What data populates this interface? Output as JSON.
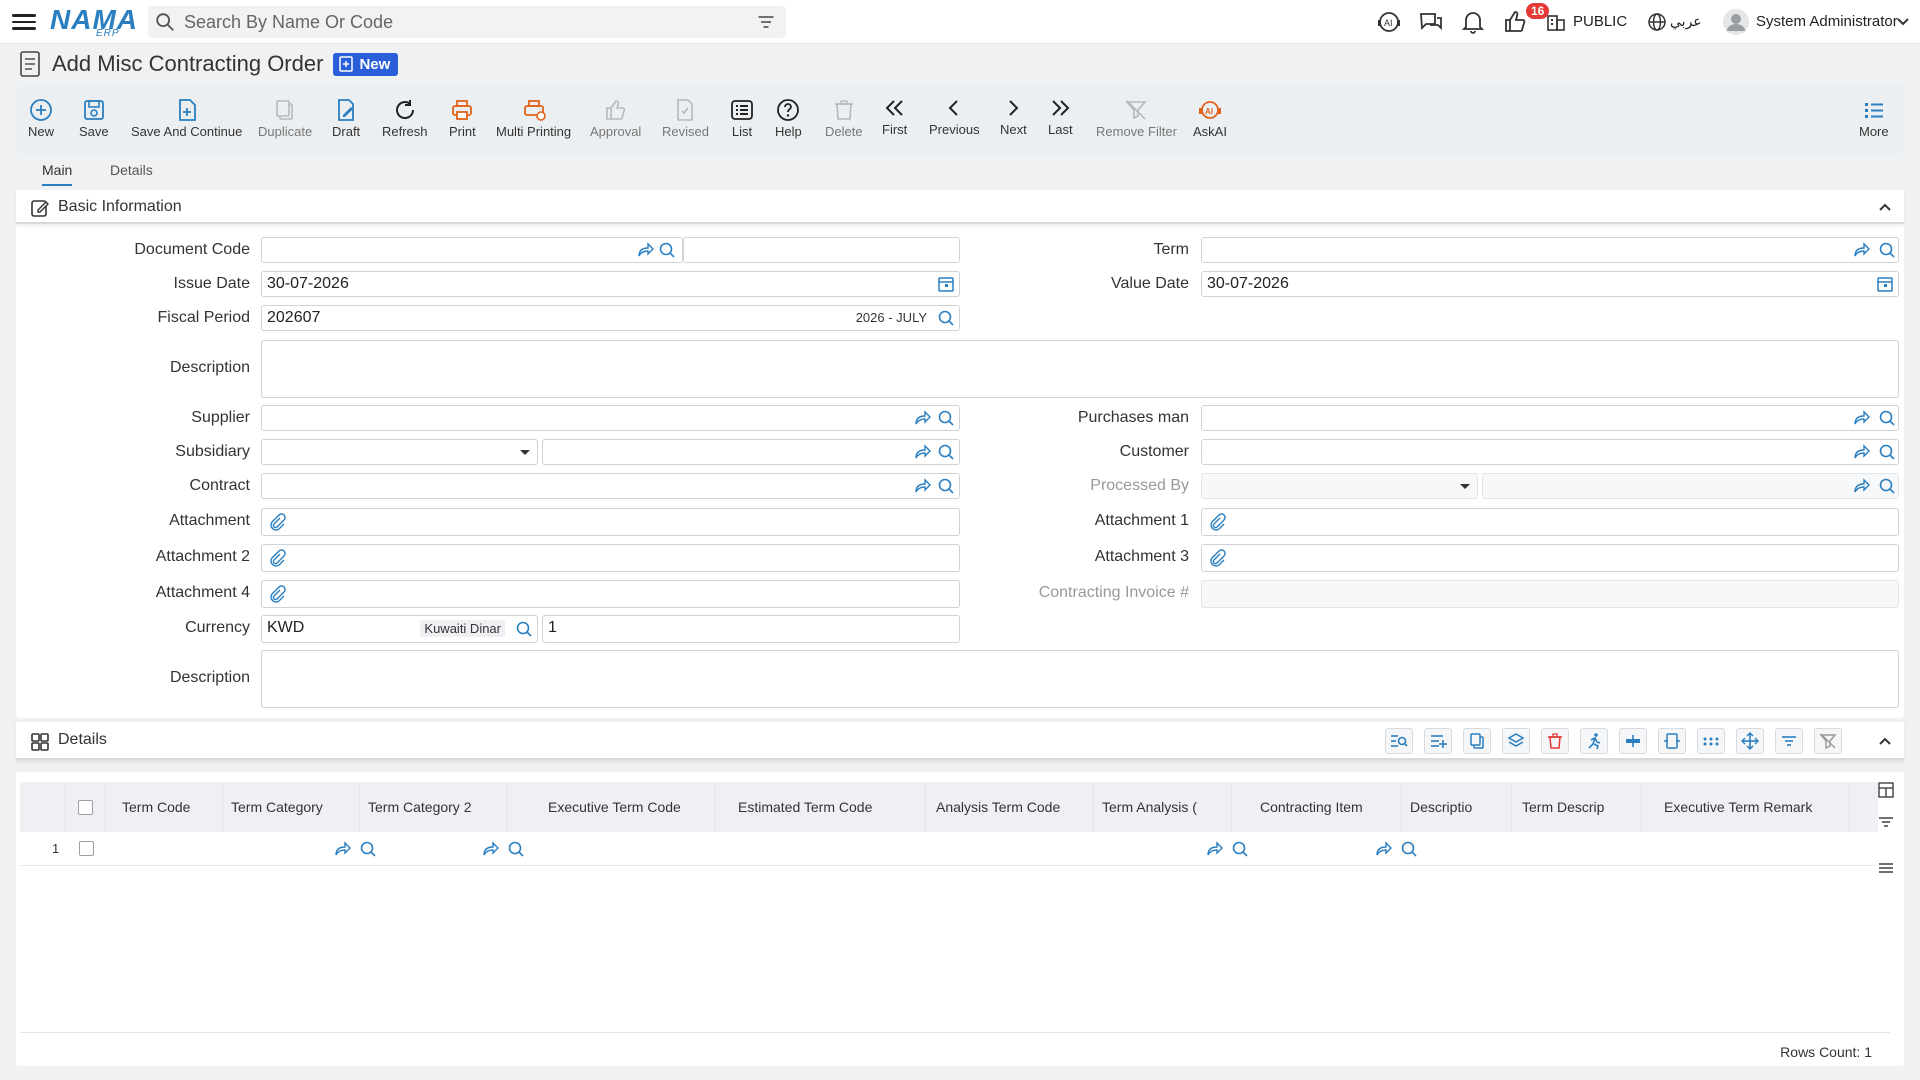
{
  "app": {
    "logo": "NAMA",
    "logo_sub": "ERP"
  },
  "search": {
    "placeholder": "Search By Name Or Code"
  },
  "header": {
    "notifications_count": "16",
    "branch": "PUBLIC",
    "language": "عربي",
    "user": "System Administrator"
  },
  "page": {
    "title": "Add Misc Contracting Order",
    "status_badge": "New"
  },
  "toolbar": [
    {
      "label": "New",
      "icon": "plus-circle-icon",
      "enabled": true
    },
    {
      "label": "Save",
      "icon": "save-icon",
      "enabled": true
    },
    {
      "label": "Save And Continue",
      "icon": "save-continue-icon",
      "enabled": true
    },
    {
      "label": "Duplicate",
      "icon": "duplicate-icon",
      "enabled": false
    },
    {
      "label": "Draft",
      "icon": "draft-icon",
      "enabled": true
    },
    {
      "label": "Refresh",
      "icon": "refresh-icon",
      "enabled": true
    },
    {
      "label": "Print",
      "icon": "print-icon",
      "enabled": true
    },
    {
      "label": "Multi Printing",
      "icon": "multi-print-icon",
      "enabled": true
    },
    {
      "label": "Approval",
      "icon": "thumbs-up-icon",
      "enabled": false
    },
    {
      "label": "Revised",
      "icon": "revised-icon",
      "enabled": false
    },
    {
      "label": "List",
      "icon": "list-icon",
      "enabled": true
    },
    {
      "label": "Help",
      "icon": "help-icon",
      "enabled": true
    },
    {
      "label": "Delete",
      "icon": "trash-icon",
      "enabled": false
    },
    {
      "label": "First",
      "icon": "double-chevron-left-icon",
      "enabled": true
    },
    {
      "label": "Previous",
      "icon": "chevron-left-icon",
      "enabled": true
    },
    {
      "label": "Next",
      "icon": "chevron-right-icon",
      "enabled": true
    },
    {
      "label": "Last",
      "icon": "double-chevron-right-icon",
      "enabled": true
    },
    {
      "label": "Remove Filter",
      "icon": "remove-filter-icon",
      "enabled": false
    },
    {
      "label": "AskAI",
      "icon": "ai-icon",
      "enabled": true
    },
    {
      "label": "More",
      "icon": "more-list-icon",
      "enabled": true
    }
  ],
  "tabs": [
    {
      "label": "Main",
      "active": true
    },
    {
      "label": "Details",
      "active": false
    }
  ],
  "basic_info": {
    "title": "Basic Information",
    "labels": {
      "document_code": "Document Code",
      "term": "Term",
      "issue_date": "Issue Date",
      "value_date": "Value Date",
      "fiscal_period": "Fiscal Period",
      "description": "Description",
      "supplier": "Supplier",
      "purchases_man": "Purchases man",
      "subsidiary": "Subsidiary",
      "customer": "Customer",
      "contract": "Contract",
      "processed_by": "Processed By",
      "attachment": "Attachment",
      "attachment_1": "Attachment 1",
      "attachment_2": "Attachment 2",
      "attachment_3": "Attachment 3",
      "attachment_4": "Attachment 4",
      "contracting_invoice": "Contracting Invoice #",
      "currency": "Currency",
      "description_2": "Description"
    },
    "values": {
      "issue_date": "30-07-2026",
      "value_date": "30-07-2026",
      "fiscal_period": "202607",
      "fiscal_period_name": "2026 - JULY",
      "currency": "KWD",
      "currency_name": "Kuwaiti Dinar",
      "rate": "1"
    }
  },
  "details": {
    "title": "Details",
    "columns": [
      "Term Code",
      "Term Category",
      "Term Category 2",
      "Executive Term Code",
      "Estimated Term Code",
      "Analysis Term Code",
      "Term Analysis (",
      "Contracting Item",
      "Descriptio",
      "Term Descrip",
      "Executive Term Remark"
    ],
    "rows": [
      {
        "num": "1"
      }
    ],
    "rows_count_label": "Rows Count: 1"
  }
}
